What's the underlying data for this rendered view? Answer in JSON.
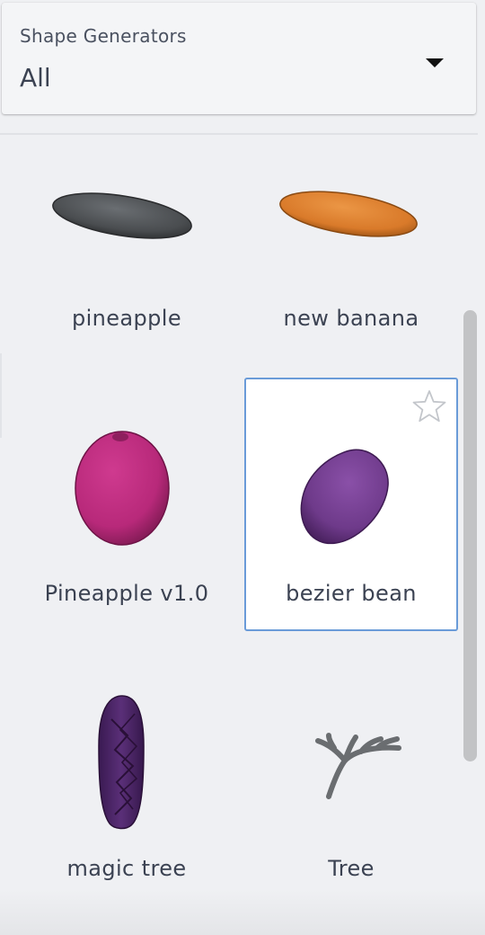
{
  "filter": {
    "label": "Shape Generators",
    "value": "All",
    "caret_icon": "caret-down-icon"
  },
  "generators": [
    {
      "name": "pineapple",
      "color": "#4a4d50",
      "shape": "flat-ellipse"
    },
    {
      "name": "new banana",
      "color": "#d97a2a",
      "shape": "flat-ellipse"
    },
    {
      "name": "Pineapple v1.0",
      "color": "#b8297a",
      "shape": "ellipsoid"
    },
    {
      "name": "bezier bean",
      "color": "#6e3a8a",
      "shape": "bean",
      "selected": true,
      "favorite_icon": "star-outline-icon"
    },
    {
      "name": "magic tree",
      "color": "#4a2566",
      "shape": "capsule"
    },
    {
      "name": "Tree",
      "color": "#6a6d70",
      "shape": "branching-tree"
    }
  ]
}
